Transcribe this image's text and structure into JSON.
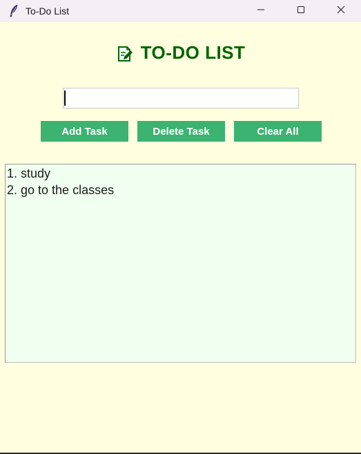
{
  "window": {
    "title": "To-Do List",
    "icon": "feather-icon",
    "controls": [
      "minimize-icon",
      "maximize-icon",
      "close-icon"
    ]
  },
  "header": {
    "icon": "memo-edit-icon",
    "title": "TO-DO LIST",
    "color": "#006400"
  },
  "input": {
    "value": "",
    "placeholder": ""
  },
  "buttons": {
    "add_label": "Add Task",
    "delete_label": "Delete Task",
    "clear_label": "Clear All",
    "color": "#3cb371"
  },
  "tasks": [
    "1. study",
    "2. go to the classes"
  ],
  "colors": {
    "background": "#ffffe0",
    "list_background": "#f0fff0",
    "titlebar": "#f5eef5"
  }
}
